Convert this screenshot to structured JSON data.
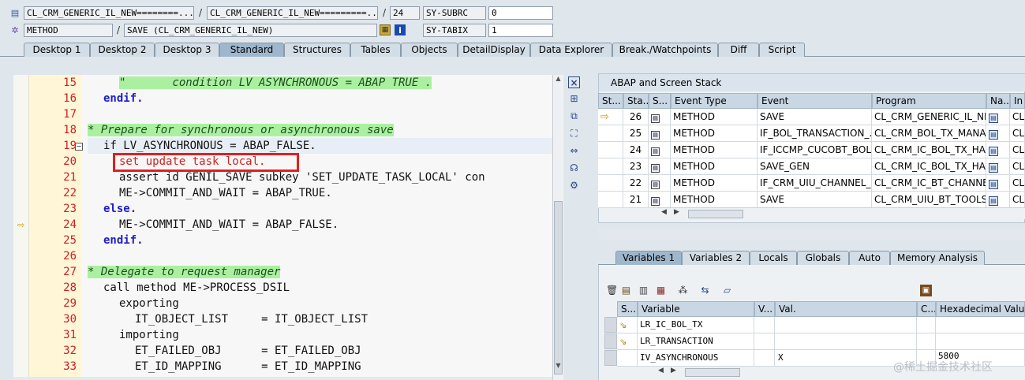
{
  "top_fields": {
    "row1": {
      "include": "CL_CRM_GENERIC_IL_NEW========...",
      "program": "CL_CRM_GENERIC_IL_NEW=========...",
      "line": "24",
      "sysvar": "SY-SUBRC",
      "sysval": "0"
    },
    "row2": {
      "event_type": "METHOD",
      "event": "SAVE (CL_CRM_GENERIC_IL_NEW)",
      "sysvar": "SY-TABIX",
      "sysval": "1"
    }
  },
  "tabs": [
    "Desktop 1",
    "Desktop 2",
    "Desktop 3",
    "Standard",
    "Structures",
    "Tables",
    "Objects",
    "DetailDisplay",
    "Data Explorer",
    "Break./Watchpoints",
    "Diff",
    "Script"
  ],
  "active_tab": "Standard",
  "editor": {
    "line_numbers": [
      "15",
      "16",
      "17",
      "18",
      "19",
      "20",
      "21",
      "22",
      "23",
      "24",
      "25",
      "26",
      "27",
      "28",
      "29",
      "30",
      "31",
      "32",
      "33"
    ],
    "lines": [
      "\"       condition LV ASYNCHRONOUS = ABAP TRUE .",
      "endif.",
      "",
      "* Prepare for synchronous or asynchronous save",
      "if LV_ASYNCHRONOUS = ABAP_FALSE.",
      "set update task local.",
      "assert id GENIL_SAVE subkey 'SET_UPDATE_TASK_LOCAL' con",
      "ME->COMMIT_AND_WAIT = ABAP_TRUE.",
      "else.",
      "ME->COMMIT_AND_WAIT = ABAP_FALSE.",
      "endif.",
      "",
      "* Delegate to request manager",
      "call method ME->PROCESS_DSIL",
      "exporting",
      "IT_OBJECT_LIST     = IT_OBJECT_LIST",
      "importing",
      "ET_FAILED_OBJ      = ET_FAILED_OBJ",
      "ET_ID_MAPPING      = ET_ID_MAPPING"
    ]
  },
  "stack": {
    "title": "ABAP and Screen Stack",
    "columns": [
      "St...",
      "Sta...",
      "S...",
      "Event Type",
      "Event",
      "Program",
      "Na...",
      "In"
    ],
    "rows": [
      {
        "level": "26",
        "type": "METHOD",
        "event": "SAVE",
        "program": "CL_CRM_GENERIC_IL_NE...",
        "inc": "CL",
        "current": true
      },
      {
        "level": "25",
        "type": "METHOD",
        "event": "IF_BOL_TRANSACTION_...",
        "program": "CL_CRM_BOL_TX_MANA...",
        "inc": "CL",
        "current": false
      },
      {
        "level": "24",
        "type": "METHOD",
        "event": "IF_ICCMP_CUCOBT_BOL...",
        "program": "CL_CRM_IC_BOL_TX_HA...",
        "inc": "CL",
        "current": false
      },
      {
        "level": "23",
        "type": "METHOD",
        "event": "SAVE_GEN",
        "program": "CL_CRM_IC_BOL_TX_HA...",
        "inc": "CL",
        "current": false
      },
      {
        "level": "22",
        "type": "METHOD",
        "event": "IF_CRM_UIU_CHANNEL_...",
        "program": "CL_CRM_IC_BT_CHANNE...",
        "inc": "CL",
        "current": false
      },
      {
        "level": "21",
        "type": "METHOD",
        "event": "SAVE",
        "program": "CL_CRM_UIU_BT_TOOLS...",
        "inc": "CL",
        "current": false
      }
    ]
  },
  "var_tabs": [
    "Variables 1",
    "Variables 2",
    "Locals",
    "Globals",
    "Auto",
    "Memory Analysis"
  ],
  "active_var_tab": "Variables 1",
  "variables": {
    "columns": [
      "S...",
      "Variable",
      "V...",
      "Val.",
      "C...",
      "Hexadecimal Value"
    ],
    "rows": [
      {
        "name": "LR_IC_BOL_TX",
        "val": "",
        "hex": ""
      },
      {
        "name": "LR_TRANSACTION",
        "val": "",
        "hex": ""
      },
      {
        "name": "IV_ASYNCHRONOUS",
        "val": "X",
        "hex": "5800"
      }
    ]
  },
  "watermark": "@稀土掘金技术社区",
  "colors": {
    "highlight_box": "#e0201e",
    "comment_bg": "#aaf0a0",
    "keyword": "#1e1ecc",
    "line_number": "#cf2121"
  }
}
